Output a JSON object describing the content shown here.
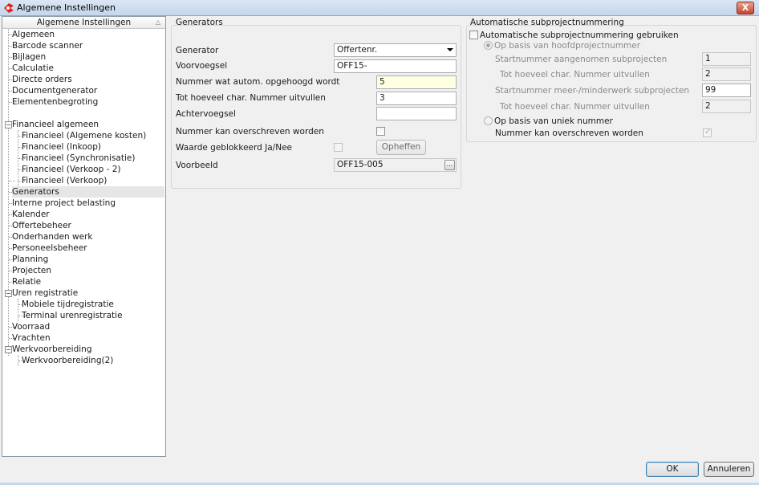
{
  "window": {
    "title": "Algemene Instellingen",
    "close_glyph": "X"
  },
  "tree": {
    "header": "Algemene Instellingen",
    "sort_glyph": "△",
    "items": [
      "Algemeen",
      "Barcode scanner",
      "Bijlagen",
      "Calculatie",
      "Directe orders",
      "Documentgenerator",
      "Elementenbegroting",
      "Financieel algemeen",
      "Financieel (Algemene kosten)",
      "Financieel (Inkoop)",
      "Financieel (Synchronisatie)",
      "Financieel (Verkoop - 2)",
      "Financieel (Verkoop)",
      "Generators",
      "Interne project belasting",
      "Kalender",
      "Offertebeheer",
      "Onderhanden werk",
      "Personeelsbeheer",
      "Planning",
      "Projecten",
      "Relatie",
      "Uren registratie",
      "Mobiele tijdregistratie",
      "Terminal urenregistratie",
      "Voorraad",
      "Vrachten",
      "Werkvoorbereiding",
      "Werkvoorbereiding(2)"
    ],
    "collapse_glyph": "−",
    "selected": "Generators"
  },
  "generators": {
    "group_title": "Generators",
    "generator_label": "Generator",
    "generator_value": "Offertenr.",
    "voorvoegsel_label": "Voorvoegsel",
    "voorvoegsel_value": "OFF15-",
    "nummer_label": "Nummer wat autom. opgehoogd wordt",
    "nummer_value": "5",
    "tot_hoeveel_label": "Tot hoeveel char. Nummer uitvullen",
    "tot_hoeveel_value": "3",
    "achtervoegsel_label": "Achtervoegsel",
    "achtervoegsel_value": "",
    "overschrijven_label": "Nummer kan overschreven worden",
    "geblokkeerd_label": "Waarde geblokkeerd Ja/Nee",
    "opheffen_label": "Opheffen",
    "voorbeeld_label": "Voorbeeld",
    "voorbeeld_value": "OFF15-005",
    "ellipsis_glyph": "..."
  },
  "auto": {
    "group_title": "Automatische subprojectnummering",
    "gebruiken_label": "Automatische subprojectnummering gebruiken",
    "hoofd_label": "Op basis van hoofdprojectnummer",
    "start_aangenomen_label": "Startnummer aangenomen subprojecten",
    "start_aangenomen_value": "1",
    "tot_hoeveel_1_label": "Tot hoeveel char. Nummer uitvullen",
    "tot_hoeveel_1_value": "2",
    "start_meer_label": "Startnummer meer-/minderwerk subprojecten",
    "start_meer_value": "99",
    "tot_hoeveel_2_label": "Tot hoeveel char. Nummer uitvullen",
    "tot_hoeveel_2_value": "2",
    "uniek_label": "Op basis van uniek nummer",
    "overschrijven_label": "Nummer kan overschreven worden",
    "check_glyph": "✓"
  },
  "buttons": {
    "ok": "OK",
    "annuleren": "Annuleren"
  }
}
